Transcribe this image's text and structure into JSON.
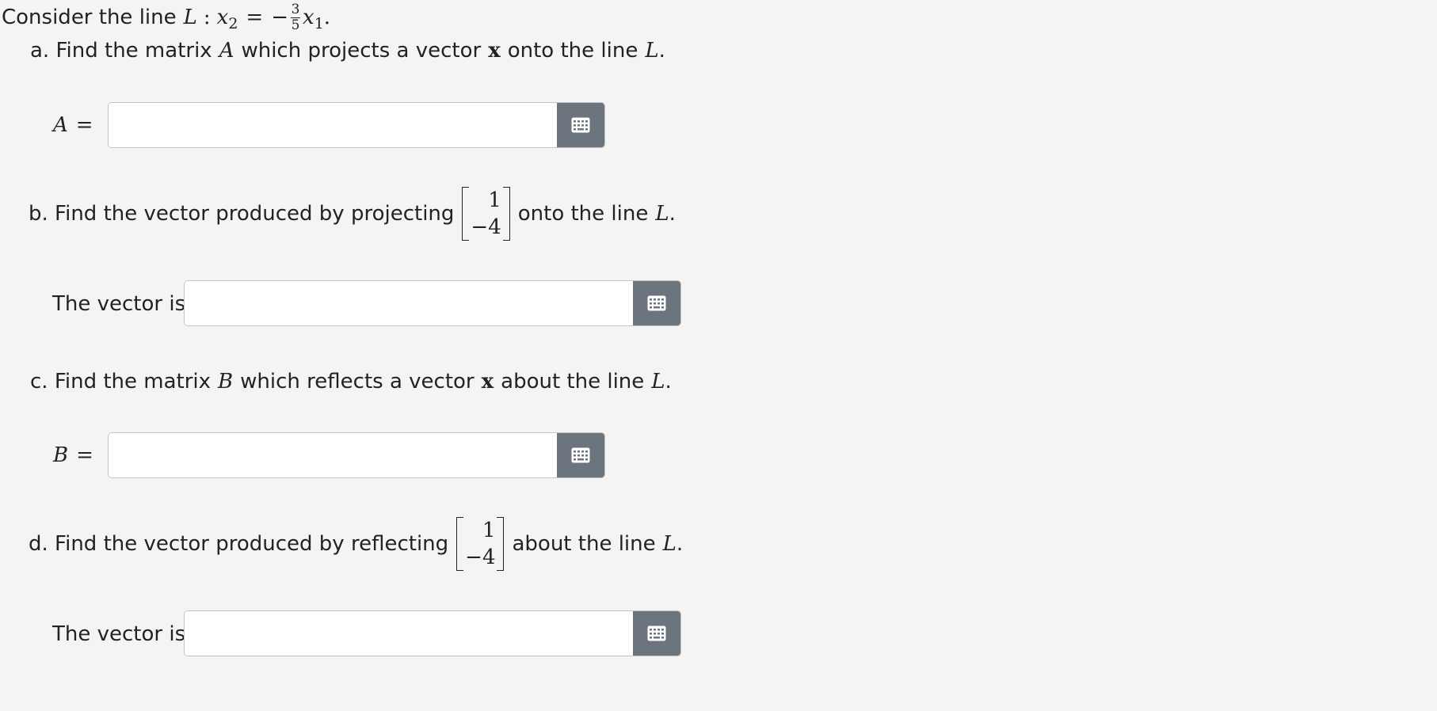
{
  "intro": {
    "text": "Consider the line",
    "line_name": "L",
    "colon": ":",
    "lhs_var": "x",
    "lhs_sub": "2",
    "equals": "=",
    "minus": "−",
    "frac_num": "3",
    "frac_den": "5",
    "rhs_var": "x",
    "rhs_sub": "1",
    "end": "."
  },
  "part_a": {
    "prefix": "a. Find the matrix",
    "matrix_name": "A",
    "middle": "which projects a vector",
    "vector_name": "x",
    "suffix": "onto the line",
    "line_name": "L",
    "end": ".",
    "answer_var": "A",
    "answer_eq": "=",
    "input_value": "",
    "keyboard_icon": "keyboard-icon"
  },
  "part_b": {
    "prefix": "b. Find the vector produced by projecting",
    "vector_entries": [
      "1",
      "−4"
    ],
    "suffix": "onto the line",
    "line_name": "L",
    "end": ".",
    "answer_label": "The vector is",
    "input_value": "",
    "keyboard_icon": "keyboard-icon"
  },
  "part_c": {
    "prefix": "c. Find the matrix",
    "matrix_name": "B",
    "middle": "which reflects a vector",
    "vector_name": "x",
    "suffix": "about the line",
    "line_name": "L",
    "end": ".",
    "answer_var": "B",
    "answer_eq": "=",
    "input_value": "",
    "keyboard_icon": "keyboard-icon"
  },
  "part_d": {
    "prefix": "d. Find the vector produced by reflecting",
    "vector_entries": [
      "1",
      "−4"
    ],
    "suffix": "about the line",
    "line_name": "L",
    "end": ".",
    "answer_label": "The vector is",
    "input_value": "",
    "keyboard_icon": "keyboard-icon"
  },
  "colors": {
    "background": "#f4f4f4",
    "button": "#6c757d",
    "input_border": "#c3c3c3",
    "text": "#222222"
  }
}
